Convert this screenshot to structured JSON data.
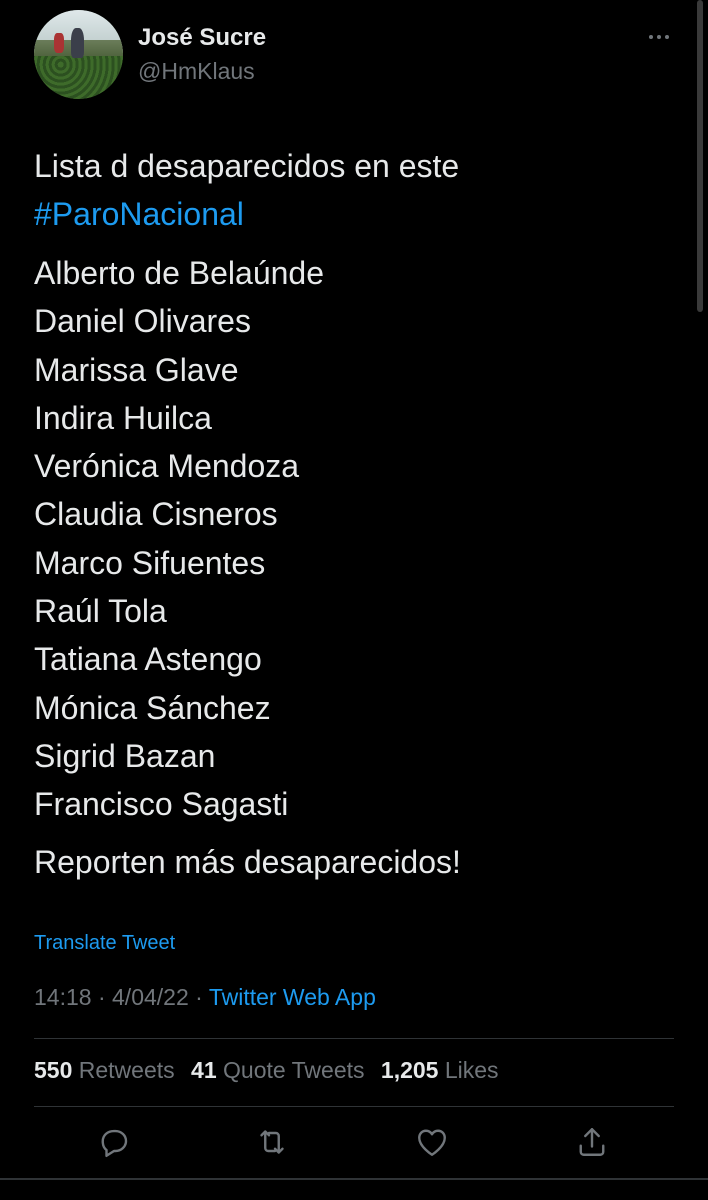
{
  "user": {
    "name": "José Sucre",
    "handle": "@HmKlaus"
  },
  "tweet": {
    "intro": "Lista d desaparecidos en este",
    "hashtag": "#ParoNacional",
    "names": [
      "Alberto de Belaúnde",
      "Daniel Olivares",
      "Marissa Glave",
      "Indira Huilca",
      "Verónica Mendoza",
      "Claudia Cisneros",
      "Marco Sifuentes",
      "Raúl Tola",
      "Tatiana Astengo",
      "Mónica Sánchez",
      "Sigrid Bazan",
      "Francisco Sagasti"
    ],
    "closing": "Reporten más desaparecidos!"
  },
  "translate_label": "Translate Tweet",
  "meta": {
    "time": "14:18",
    "separator": "·",
    "date": "4/04/22",
    "source": "Twitter Web App"
  },
  "stats": {
    "retweets_count": "550",
    "retweets_label": "Retweets",
    "quotes_count": "41",
    "quotes_label": "Quote Tweets",
    "likes_count": "1,205",
    "likes_label": "Likes"
  },
  "icons": {
    "more": "more-options-icon",
    "reply": "reply-icon",
    "retweet": "retweet-icon",
    "like": "heart-icon",
    "share": "share-icon"
  },
  "colors": {
    "background": "#000000",
    "text": "#e7e9ea",
    "secondary": "#71767b",
    "accent": "#1d9bf0"
  }
}
